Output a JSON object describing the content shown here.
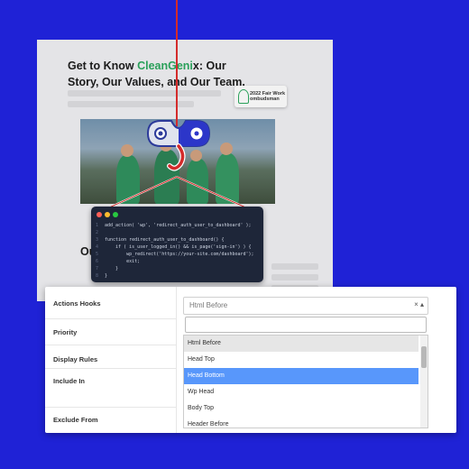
{
  "background_page": {
    "title_part1": "Get to Know ",
    "title_brand": "CleanGeni",
    "title_part2": "x: Our Story, Our Values, and Our Team.",
    "badge_line1": "2022 Fair Work",
    "badge_line2": "ombudsman",
    "section_heading": "Ou"
  },
  "code_window": {
    "lines": [
      {
        "n": "1",
        "text": "add_action( 'wp', 'redirect_auth_user_to_dashboard' );"
      },
      {
        "n": "2",
        "text": ""
      },
      {
        "n": "3",
        "text": "function redirect_auth_user_to_dashboard() {"
      },
      {
        "n": "4",
        "text": "    if ( is_user_logged_in() && is_page('sign-in') ) {"
      },
      {
        "n": "5",
        "text": "        wp_redirect('https://your-site.com/dashboard');"
      },
      {
        "n": "6",
        "text": "        exit;"
      },
      {
        "n": "7",
        "text": "    }"
      },
      {
        "n": "8",
        "text": "}"
      }
    ]
  },
  "settings": {
    "actions_hooks_label": "Actions Hooks",
    "priority_label": "Priority",
    "display_rules_label": "Display Rules",
    "include_in_label": "Include In",
    "exclude_from_label": "Exclude From",
    "select_value": "Html Before",
    "select_controls": "× ▴",
    "search_value": "",
    "options": [
      "Html Before",
      "Head Top",
      "Head Bottom",
      "Wp Head",
      "Body Top",
      "Header Before"
    ],
    "highlighted_option": "Html Before",
    "selected_option": "Head Bottom"
  },
  "colors": {
    "background": "#1f22d6",
    "brand_green": "#2aa05a",
    "thread_red": "#d42b2b",
    "selected_option": "#5897fb"
  }
}
